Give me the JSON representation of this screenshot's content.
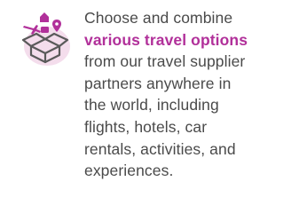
{
  "colors": {
    "accent": "#b1309a",
    "icon_line": "#5a5a5a",
    "icon_bg": "#f4ddec",
    "text": "#4a4a4a"
  },
  "icon": {
    "name": "open-box-travel-icon"
  },
  "description": {
    "line1": "Choose and combine",
    "highlight": "various travel options",
    "line3": "from our travel supplier",
    "line4": "partners anywhere in",
    "line5": "the world, including",
    "line6": "flights, hotels, car",
    "line7": "rentals, activities, and",
    "line8": "experiences."
  }
}
